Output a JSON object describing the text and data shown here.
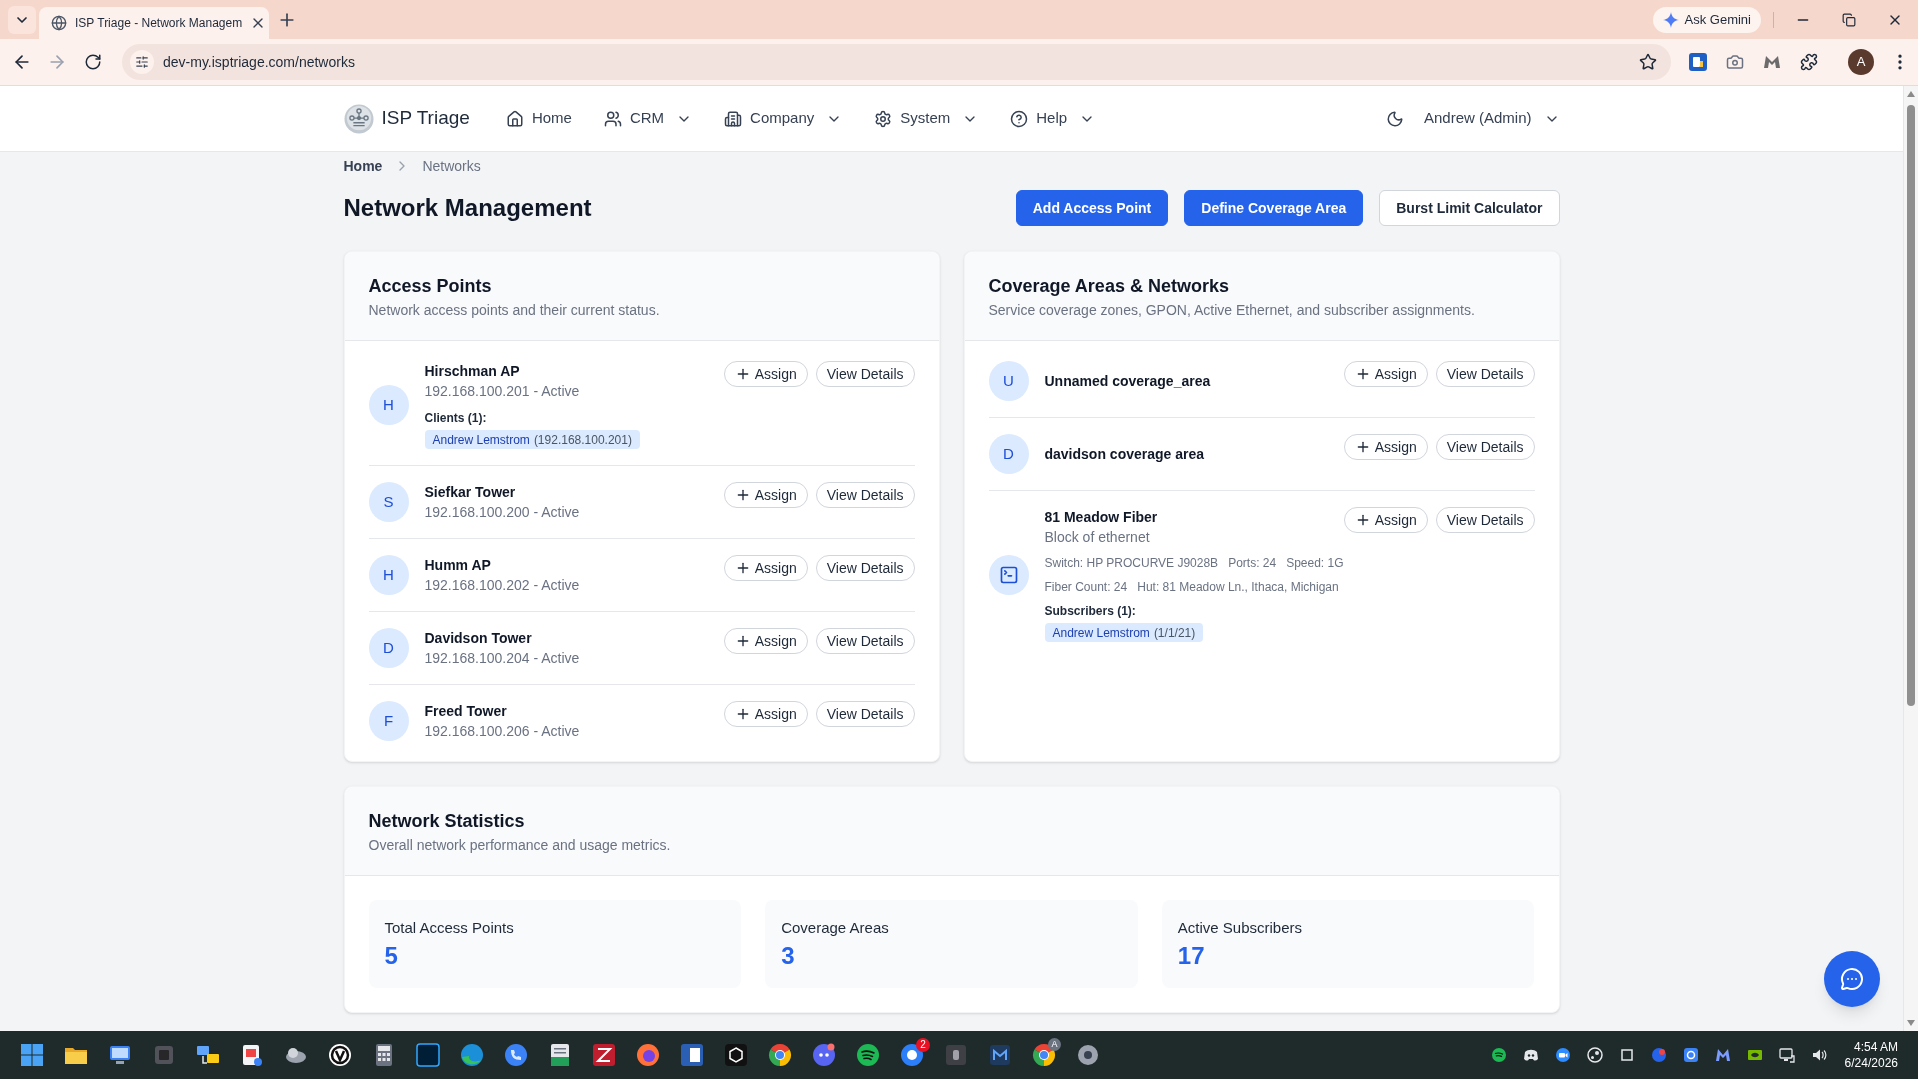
{
  "browser": {
    "tab_title": "ISP Triage - Network Managem",
    "ask_button": "Ask Gemini",
    "url": "dev-my.isptriage.com/networks",
    "profile_initial": "A"
  },
  "app_header": {
    "brand": "ISP Triage",
    "nav": [
      {
        "label": "Home",
        "dropdown": false
      },
      {
        "label": "CRM",
        "dropdown": true
      },
      {
        "label": "Company",
        "dropdown": true
      },
      {
        "label": "System",
        "dropdown": true
      },
      {
        "label": "Help",
        "dropdown": true
      }
    ],
    "user": "Andrew (Admin)"
  },
  "breadcrumb": [
    {
      "label": "Home",
      "current": false
    },
    {
      "label": "Networks",
      "current": true
    }
  ],
  "page_title": "Network Management",
  "actions": [
    {
      "label": "Add Access Point",
      "kind": "primary"
    },
    {
      "label": "Define Coverage Area",
      "kind": "primary"
    },
    {
      "label": "Burst Limit Calculator",
      "kind": "secondary"
    }
  ],
  "access_points": {
    "title": "Access Points",
    "subtitle": "Network access points and their current status.",
    "items": [
      {
        "initial": "H",
        "name": "Hirschman AP",
        "detail": "192.168.100.201 - Active",
        "clients_label": "Clients (1):",
        "clients": [
          {
            "name": "Andrew Lemstrom",
            "note": "(192.168.100.201)"
          }
        ],
        "buttons": [
          {
            "label": "Assign",
            "kind": "assign"
          },
          {
            "label": "View Details",
            "kind": "details"
          }
        ]
      },
      {
        "initial": "S",
        "name": "Siefkar Tower",
        "detail": "192.168.100.200 - Active",
        "buttons": [
          {
            "label": "Assign",
            "kind": "assign"
          },
          {
            "label": "View Details",
            "kind": "details"
          }
        ]
      },
      {
        "initial": "H",
        "name": "Humm AP",
        "detail": "192.168.100.202 - Active",
        "buttons": [
          {
            "label": "Assign",
            "kind": "assign"
          },
          {
            "label": "View Details",
            "kind": "details"
          }
        ]
      },
      {
        "initial": "D",
        "name": "Davidson Tower",
        "detail": "192.168.100.204 - Active",
        "buttons": [
          {
            "label": "Assign",
            "kind": "assign"
          },
          {
            "label": "View Details",
            "kind": "details"
          }
        ]
      },
      {
        "initial": "F",
        "name": "Freed Tower",
        "detail": "192.168.100.206 - Active",
        "buttons": [
          {
            "label": "Assign",
            "kind": "assign"
          },
          {
            "label": "View Details",
            "kind": "details"
          }
        ]
      }
    ]
  },
  "coverage": {
    "title": "Coverage Areas & Networks",
    "subtitle": "Service coverage zones, GPON, Active Ethernet, and subscriber assignments.",
    "items": [
      {
        "kind": "area",
        "initial": "U",
        "name": "Unnamed coverage_area",
        "buttons": [
          {
            "label": "Assign",
            "kind": "assign"
          },
          {
            "label": "View Details",
            "kind": "details"
          }
        ]
      },
      {
        "kind": "area",
        "initial": "D",
        "name": "davidson coverage area",
        "buttons": [
          {
            "label": "Assign",
            "kind": "assign"
          },
          {
            "label": "View Details",
            "kind": "details"
          }
        ]
      },
      {
        "kind": "network",
        "name": "81 Meadow Fiber",
        "description": "Block of ethernet",
        "specs": [
          [
            "Switch: HP PROCURVE J9028B",
            "Ports: 24",
            "Speed: 1G"
          ],
          [
            "Fiber Count: 24",
            "Hut: 81 Meadow Ln., Ithaca, Michigan"
          ]
        ],
        "subscribers_label": "Subscribers (1):",
        "subscribers": [
          {
            "name": "Andrew Lemstrom",
            "note": "(1/1/21)"
          }
        ],
        "buttons": [
          {
            "label": "Assign",
            "kind": "assign"
          },
          {
            "label": "View Details",
            "kind": "details"
          }
        ]
      }
    ]
  },
  "statistics": {
    "title": "Network Statistics",
    "subtitle": "Overall network performance and usage metrics.",
    "items": [
      {
        "label": "Total Access Points",
        "value": "5"
      },
      {
        "label": "Coverage Areas",
        "value": "3"
      },
      {
        "label": "Active Subscribers",
        "value": "17"
      }
    ]
  },
  "taskbar": {
    "badge": "2",
    "browser_badge": "A",
    "time": "4:54 AM",
    "date": "6/24/2026"
  }
}
